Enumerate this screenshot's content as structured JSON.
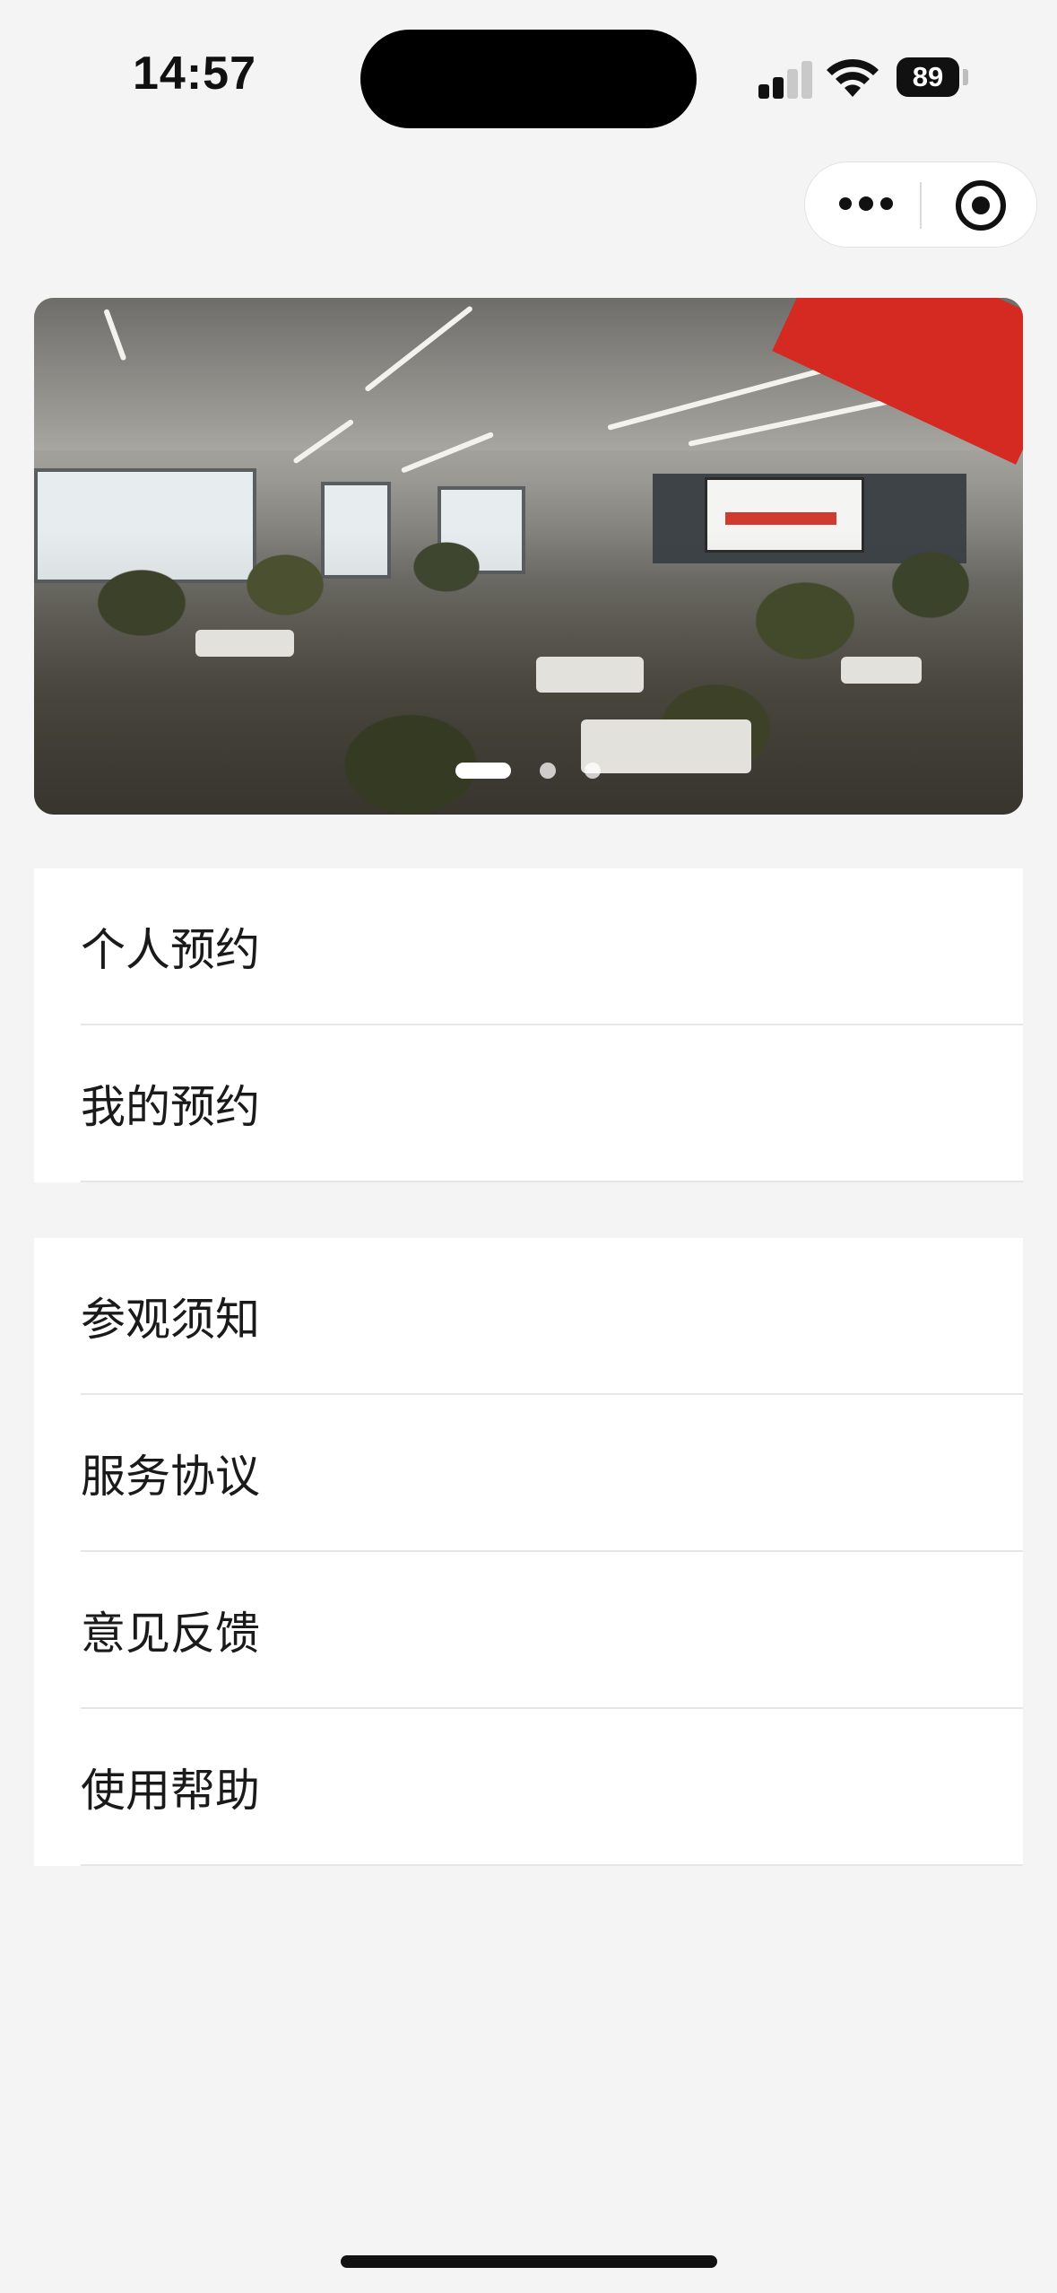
{
  "status_bar": {
    "time": "14:57",
    "battery": "89",
    "icons": [
      "cellular-signal-icon",
      "wifi-icon",
      "battery-icon"
    ]
  },
  "capsule": {
    "icons": [
      "more-dots-icon",
      "close-target-icon"
    ]
  },
  "banner": {
    "slide_count": 3,
    "active_index": 0
  },
  "menu": {
    "group1": [
      {
        "label": "个人预约"
      },
      {
        "label": "我的预约"
      }
    ],
    "group2": [
      {
        "label": "参观须知"
      },
      {
        "label": "服务协议"
      },
      {
        "label": "意见反馈"
      },
      {
        "label": "使用帮助"
      }
    ]
  },
  "colors": {
    "background": "#f4f4f4",
    "card": "#ffffff",
    "divider": "#e6e6e6",
    "text": "#1a1a1a"
  }
}
